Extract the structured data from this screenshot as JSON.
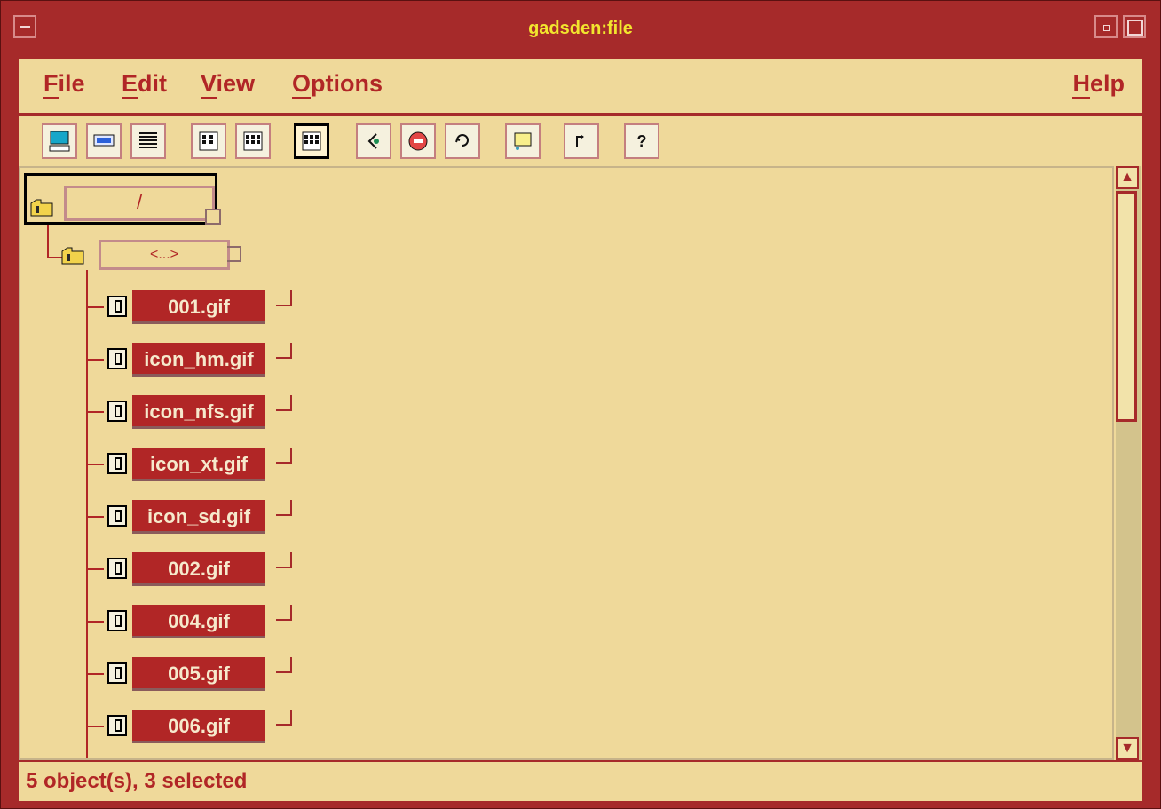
{
  "window": {
    "title": "gadsden:file"
  },
  "menubar": {
    "items": [
      "File",
      "Edit",
      "View",
      "Options"
    ],
    "help": "Help"
  },
  "toolbar": {
    "icons": [
      "large-icon-view-icon",
      "small-icon-view-icon",
      "list-view-icon",
      "columns-view-icon",
      "grid-view-icon",
      "active-view-icon",
      "back-icon",
      "stop-icon",
      "refresh-icon",
      "select-icon",
      "up-icon",
      "help-icon"
    ],
    "help_label": "?"
  },
  "tree": {
    "root_label": "/",
    "parent_label": "<...>",
    "files": [
      "001.gif",
      "icon_hm.gif",
      "icon_nfs.gif",
      "icon_xt.gif",
      "icon_sd.gif",
      "002.gif",
      "004.gif",
      "005.gif",
      "006.gif"
    ]
  },
  "status": {
    "text": "5 object(s), 3 selected"
  }
}
